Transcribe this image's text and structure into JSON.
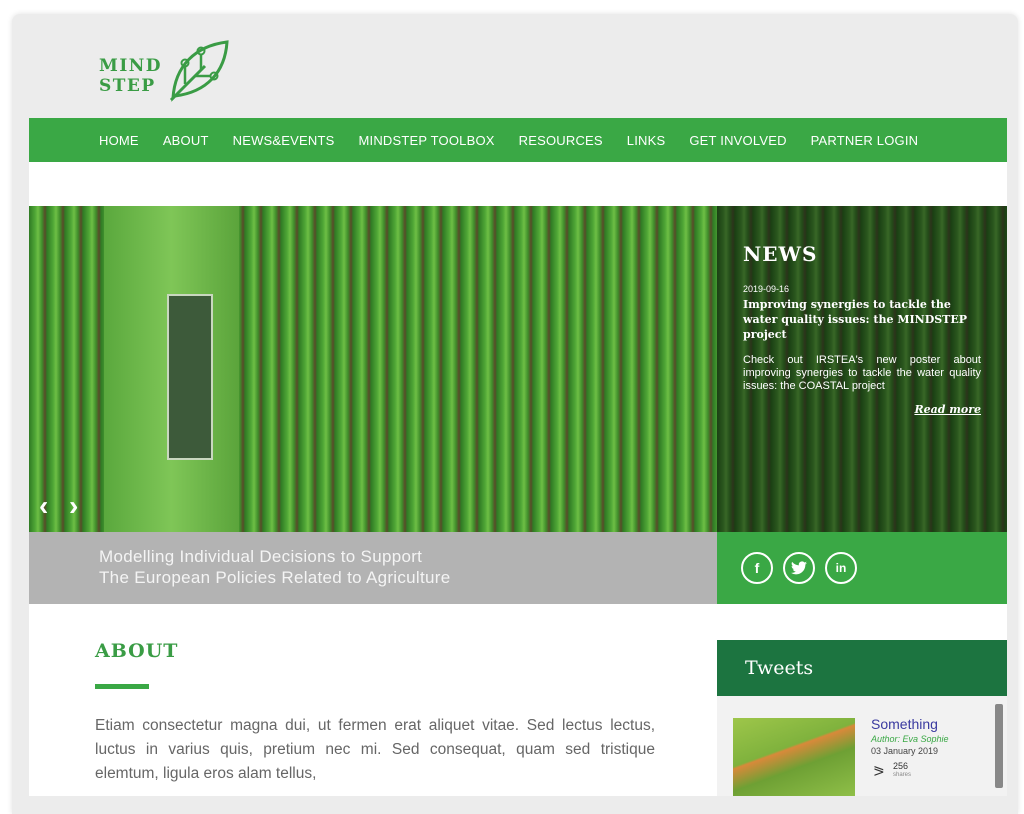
{
  "brand": {
    "line1": "MIND",
    "line2": "STEP"
  },
  "nav": {
    "items": [
      "HOME",
      "ABOUT",
      "NEWS&EVENTS",
      "MINDSTEP TOOLBOX",
      "RESOURCES",
      "LINKS",
      "GET INVOLVED",
      "PARTNER LOGIN"
    ]
  },
  "hero": {
    "prev_icon": "chevron-left-icon",
    "next_icon": "chevron-right-icon",
    "tagline_line1": "Modelling Individual Decisions to Support",
    "tagline_line2": "The European Policies Related to Agriculture"
  },
  "news": {
    "heading": "NEWS",
    "date": "2019-09-16",
    "title": "Improving synergies to tackle the water quality issues: the MINDSTEP project",
    "body": "Check out IRSTEA's new poster about improving synergies to tackle the water quality issues: the COASTAL project",
    "read_more": "Read more"
  },
  "social": {
    "facebook": "f",
    "twitter": "t",
    "linkedin": "in"
  },
  "about": {
    "title": "ABOUT",
    "body": "Etiam consectetur magna dui, ut fermen erat aliquet vitae. Sed lectus lectus, luctus in varius quis, pretium nec mi. Sed consequat, quam sed tristique elemtum, ligula eros alam tellus,"
  },
  "tweets": {
    "heading": "Tweets",
    "item": {
      "title": "Something",
      "author": "Author: Eva Sophie",
      "date": "03 January 2019",
      "count": "256",
      "count_label": "shares"
    }
  },
  "colors": {
    "brand_green": "#3aa845",
    "dark_green": "#1c7440",
    "gray_bar": "#b3b3b3"
  }
}
